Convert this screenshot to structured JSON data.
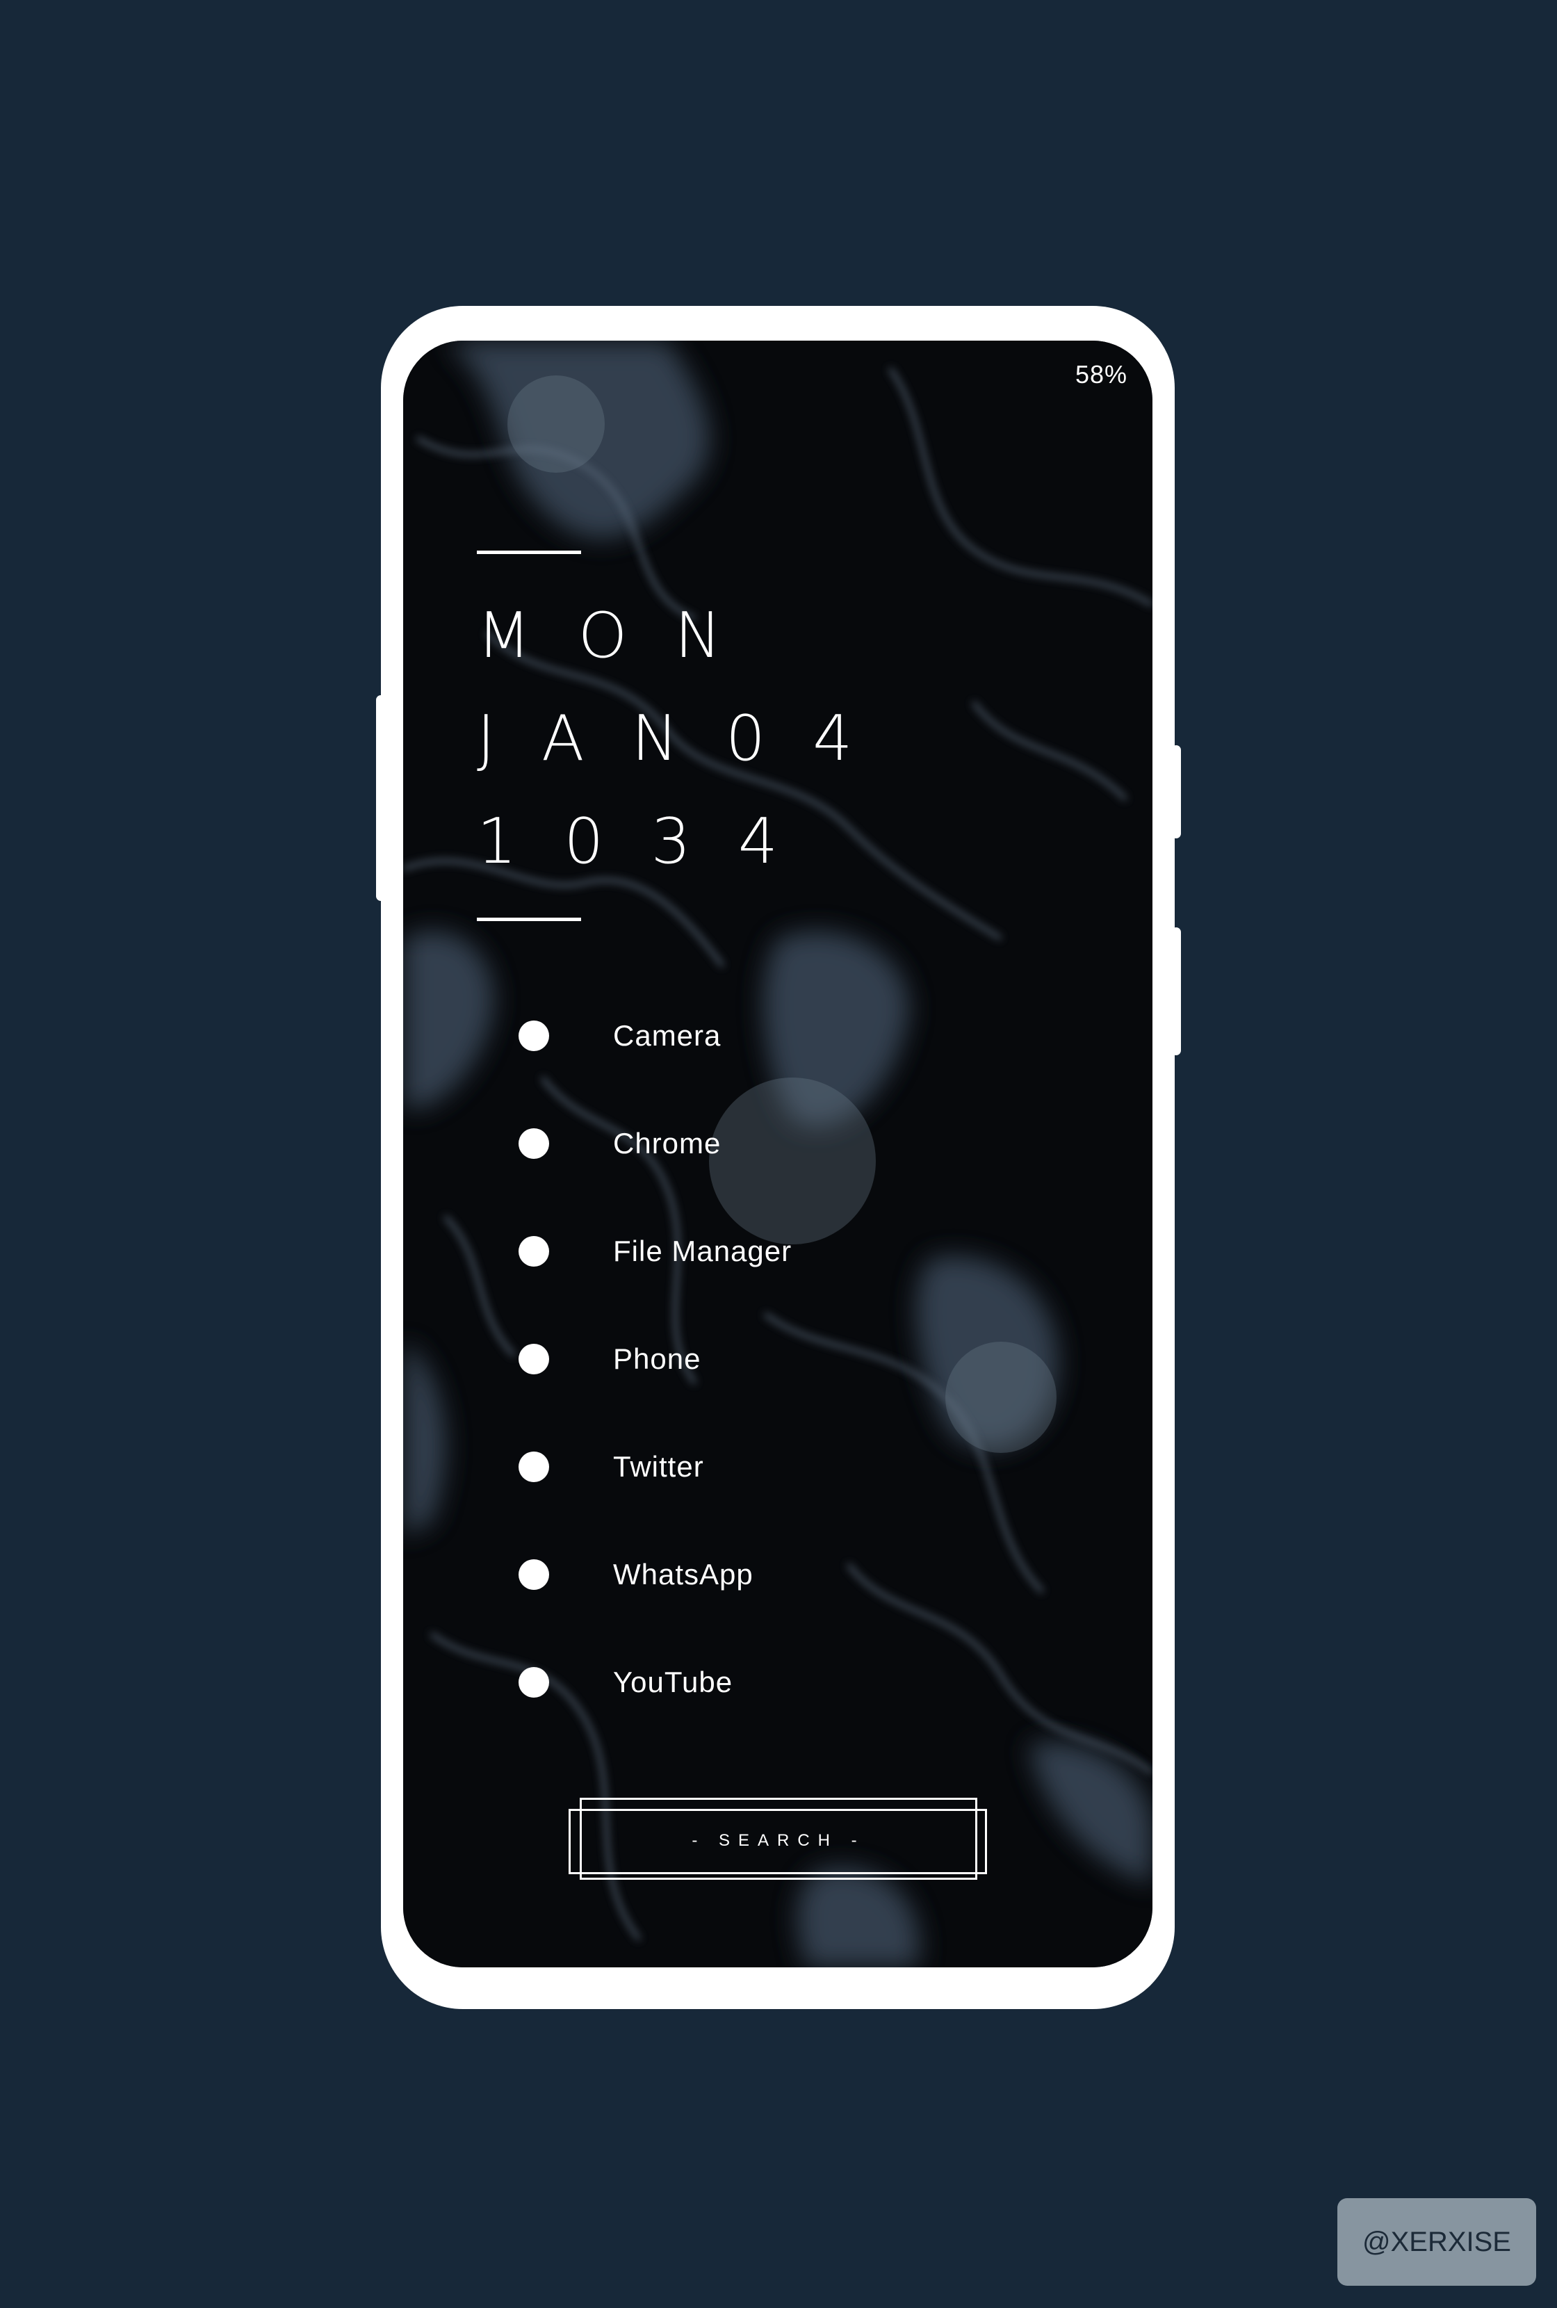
{
  "status_bar": {
    "battery": "58%"
  },
  "clock": {
    "day": "MON",
    "date": "JAN04",
    "time": "1034"
  },
  "apps": [
    {
      "label": "Camera"
    },
    {
      "label": "Chrome"
    },
    {
      "label": "File Manager"
    },
    {
      "label": "Phone"
    },
    {
      "label": "Twitter"
    },
    {
      "label": "WhatsApp"
    },
    {
      "label": "YouTube"
    }
  ],
  "search": {
    "label": "- SEARCH -"
  },
  "watermark": {
    "text": "@XERXISE"
  },
  "colors": {
    "background": "#172839",
    "phone_frame": "#ffffff",
    "text": "#ffffff",
    "watermark_bg": "#8795a0"
  }
}
